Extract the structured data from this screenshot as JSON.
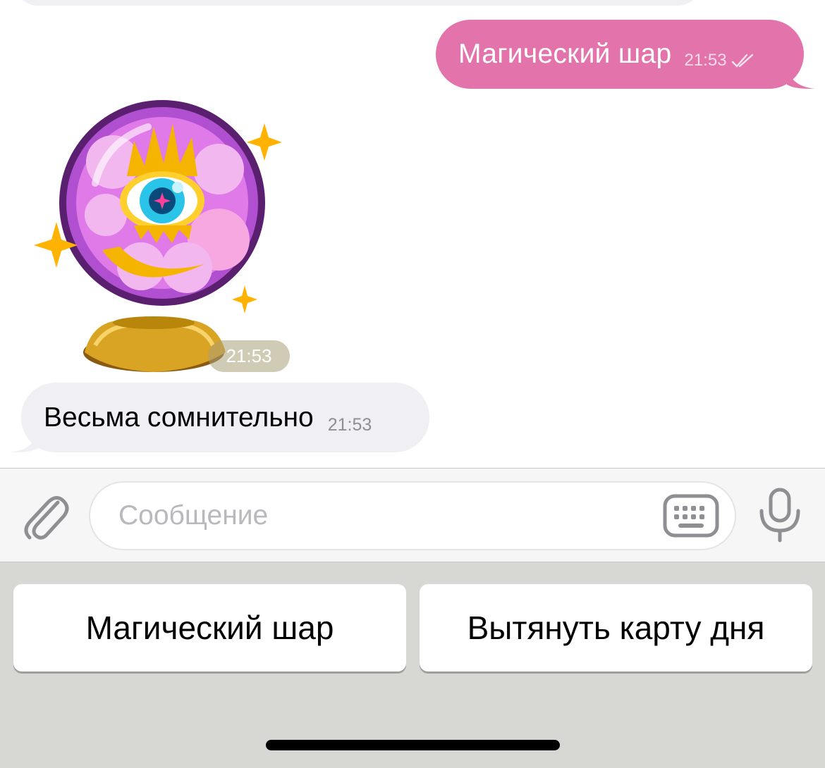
{
  "messages": {
    "outgoing": {
      "text": "Магический шар",
      "time": "21:53",
      "status": "read-double-check-icon"
    },
    "sticker": {
      "description_icon": "magic-crystal-ball-sticker",
      "time": "21:53"
    },
    "incoming": {
      "text": "Весьма сомнительно",
      "time": "21:53"
    }
  },
  "composer": {
    "placeholder": "Сообщение",
    "value": "",
    "icons": {
      "attach": "paperclip-icon",
      "keyboard": "keyboard-icon",
      "mic": "microphone-icon"
    }
  },
  "bot_keyboard": {
    "buttons": [
      {
        "label": "Магический шар"
      },
      {
        "label": "Вытянуть карту дня"
      }
    ]
  },
  "colors": {
    "outgoing_bubble": "#e374ab",
    "incoming_bubble": "#efeff4",
    "keyboard_bg": "#d7d8d3",
    "icon_gray": "#8e8e93"
  }
}
